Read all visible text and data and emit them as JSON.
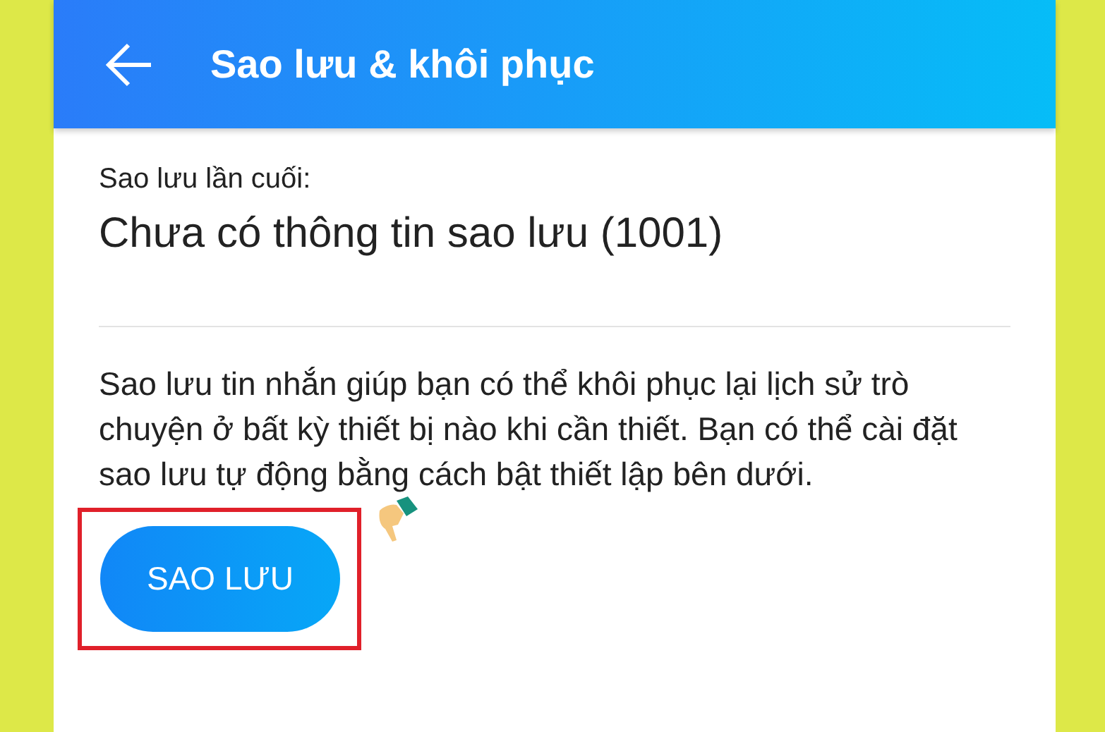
{
  "header": {
    "title": "Sao lưu & khôi phục"
  },
  "last_backup": {
    "label": "Sao lưu lần cuối:",
    "value": "Chưa có thông tin sao lưu (1001)"
  },
  "description": "Sao lưu tin nhắn giúp bạn có thể khôi phục lại lịch sử trò chuyện ở bất kỳ thiết bị nào khi cần thiết. Bạn có thể cài đặt sao lưu tự động bằng cách bật thiết lập bên dưới.",
  "backup_button": {
    "label": "SAO LƯU",
    "highlighted": true
  }
}
